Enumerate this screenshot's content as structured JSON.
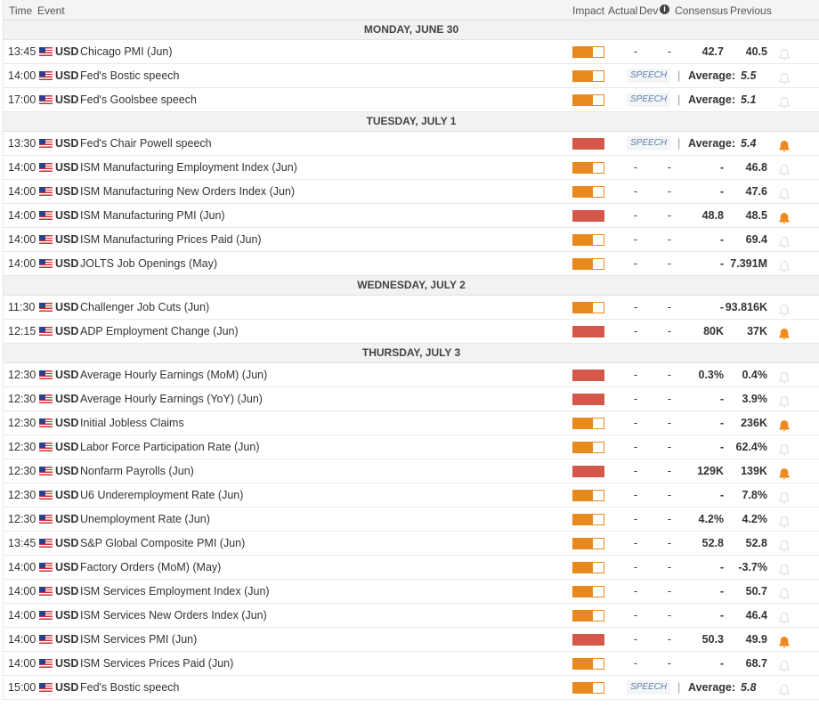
{
  "header": {
    "time": "Time",
    "event": "Event",
    "impact": "Impact",
    "actual": "Actual",
    "dev": "Dev",
    "consensus": "Consensus",
    "previous": "Previous"
  },
  "colors": {
    "medium": "#e8891d",
    "high": "#d4574a",
    "bell_on": "#f08a1c",
    "bell_off": "#d8d8d8"
  },
  "days": [
    {
      "label": "MONDAY, JUNE 30",
      "events": [
        {
          "time": "13:45",
          "cur": "USD",
          "name": "Chicago PMI (Jun)",
          "impact": "medium",
          "actual": "-",
          "dev": "-",
          "consensus": "42.7",
          "previous": "40.5",
          "alert": false
        },
        {
          "time": "14:00",
          "cur": "USD",
          "name": "Fed's Bostic speech",
          "impact": "medium",
          "speech": "SPEECH",
          "avg_label": "Average:",
          "avg": "5.5",
          "alert": false
        },
        {
          "time": "17:00",
          "cur": "USD",
          "name": "Fed's Goolsbee speech",
          "impact": "medium",
          "speech": "SPEECH",
          "avg_label": "Average:",
          "avg": "5.1",
          "alert": false
        }
      ]
    },
    {
      "label": "TUESDAY, JULY 1",
      "events": [
        {
          "time": "13:30",
          "cur": "USD",
          "name": "Fed's Chair Powell speech",
          "impact": "high",
          "speech": "SPEECH",
          "avg_label": "Average:",
          "avg": "5.4",
          "alert": true
        },
        {
          "time": "14:00",
          "cur": "USD",
          "name": "ISM Manufacturing Employment Index (Jun)",
          "impact": "medium",
          "actual": "-",
          "dev": "-",
          "consensus": "-",
          "previous": "46.8",
          "alert": false
        },
        {
          "time": "14:00",
          "cur": "USD",
          "name": "ISM Manufacturing New Orders Index (Jun)",
          "impact": "medium",
          "actual": "-",
          "dev": "-",
          "consensus": "-",
          "previous": "47.6",
          "alert": false
        },
        {
          "time": "14:00",
          "cur": "USD",
          "name": "ISM Manufacturing PMI (Jun)",
          "impact": "high",
          "actual": "-",
          "dev": "-",
          "consensus": "48.8",
          "previous": "48.5",
          "alert": true
        },
        {
          "time": "14:00",
          "cur": "USD",
          "name": "ISM Manufacturing Prices Paid (Jun)",
          "impact": "medium",
          "actual": "-",
          "dev": "-",
          "consensus": "-",
          "previous": "69.4",
          "alert": false
        },
        {
          "time": "14:00",
          "cur": "USD",
          "name": "JOLTS Job Openings (May)",
          "impact": "medium",
          "actual": "-",
          "dev": "-",
          "consensus": "-",
          "previous": "7.391M",
          "alert": false
        }
      ]
    },
    {
      "label": "WEDNESDAY, JULY 2",
      "events": [
        {
          "time": "11:30",
          "cur": "USD",
          "name": "Challenger Job Cuts (Jun)",
          "impact": "medium",
          "actual": "-",
          "dev": "-",
          "consensus": "-",
          "previous": "93.816K",
          "alert": false
        },
        {
          "time": "12:15",
          "cur": "USD",
          "name": "ADP Employment Change (Jun)",
          "impact": "high",
          "actual": "-",
          "dev": "-",
          "consensus": "80K",
          "previous": "37K",
          "alert": true
        }
      ]
    },
    {
      "label": "THURSDAY, JULY 3",
      "events": [
        {
          "time": "12:30",
          "cur": "USD",
          "name": "Average Hourly Earnings (MoM) (Jun)",
          "impact": "high",
          "actual": "-",
          "dev": "-",
          "consensus": "0.3%",
          "previous": "0.4%",
          "alert": false
        },
        {
          "time": "12:30",
          "cur": "USD",
          "name": "Average Hourly Earnings (YoY) (Jun)",
          "impact": "high",
          "actual": "-",
          "dev": "-",
          "consensus": "-",
          "previous": "3.9%",
          "alert": false
        },
        {
          "time": "12:30",
          "cur": "USD",
          "name": "Initial Jobless Claims",
          "impact": "medium",
          "actual": "-",
          "dev": "-",
          "consensus": "-",
          "previous": "236K",
          "alert": true
        },
        {
          "time": "12:30",
          "cur": "USD",
          "name": "Labor Force Participation Rate (Jun)",
          "impact": "medium",
          "actual": "-",
          "dev": "-",
          "consensus": "-",
          "previous": "62.4%",
          "alert": false
        },
        {
          "time": "12:30",
          "cur": "USD",
          "name": "Nonfarm Payrolls (Jun)",
          "impact": "high",
          "actual": "-",
          "dev": "-",
          "consensus": "129K",
          "previous": "139K",
          "alert": true
        },
        {
          "time": "12:30",
          "cur": "USD",
          "name": "U6 Underemployment Rate (Jun)",
          "impact": "medium",
          "actual": "-",
          "dev": "-",
          "consensus": "-",
          "previous": "7.8%",
          "alert": false
        },
        {
          "time": "12:30",
          "cur": "USD",
          "name": "Unemployment Rate (Jun)",
          "impact": "medium",
          "actual": "-",
          "dev": "-",
          "consensus": "4.2%",
          "previous": "4.2%",
          "alert": false
        },
        {
          "time": "13:45",
          "cur": "USD",
          "name": "S&P Global Composite PMI (Jun)",
          "impact": "medium",
          "actual": "-",
          "dev": "-",
          "consensus": "52.8",
          "previous": "52.8",
          "alert": false
        },
        {
          "time": "14:00",
          "cur": "USD",
          "name": "Factory Orders (MoM) (May)",
          "impact": "medium",
          "actual": "-",
          "dev": "-",
          "consensus": "-",
          "previous": "-3.7%",
          "alert": false
        },
        {
          "time": "14:00",
          "cur": "USD",
          "name": "ISM Services Employment Index (Jun)",
          "impact": "medium",
          "actual": "-",
          "dev": "-",
          "consensus": "-",
          "previous": "50.7",
          "alert": false
        },
        {
          "time": "14:00",
          "cur": "USD",
          "name": "ISM Services New Orders Index (Jun)",
          "impact": "medium",
          "actual": "-",
          "dev": "-",
          "consensus": "-",
          "previous": "46.4",
          "alert": false
        },
        {
          "time": "14:00",
          "cur": "USD",
          "name": "ISM Services PMI (Jun)",
          "impact": "high",
          "actual": "-",
          "dev": "-",
          "consensus": "50.3",
          "previous": "49.9",
          "alert": true
        },
        {
          "time": "14:00",
          "cur": "USD",
          "name": "ISM Services Prices Paid (Jun)",
          "impact": "medium",
          "actual": "-",
          "dev": "-",
          "consensus": "-",
          "previous": "68.7",
          "alert": false
        },
        {
          "time": "15:00",
          "cur": "USD",
          "name": "Fed's Bostic speech",
          "impact": "medium",
          "speech": "SPEECH",
          "avg_label": "Average:",
          "avg": "5.8",
          "alert": false
        }
      ]
    }
  ]
}
